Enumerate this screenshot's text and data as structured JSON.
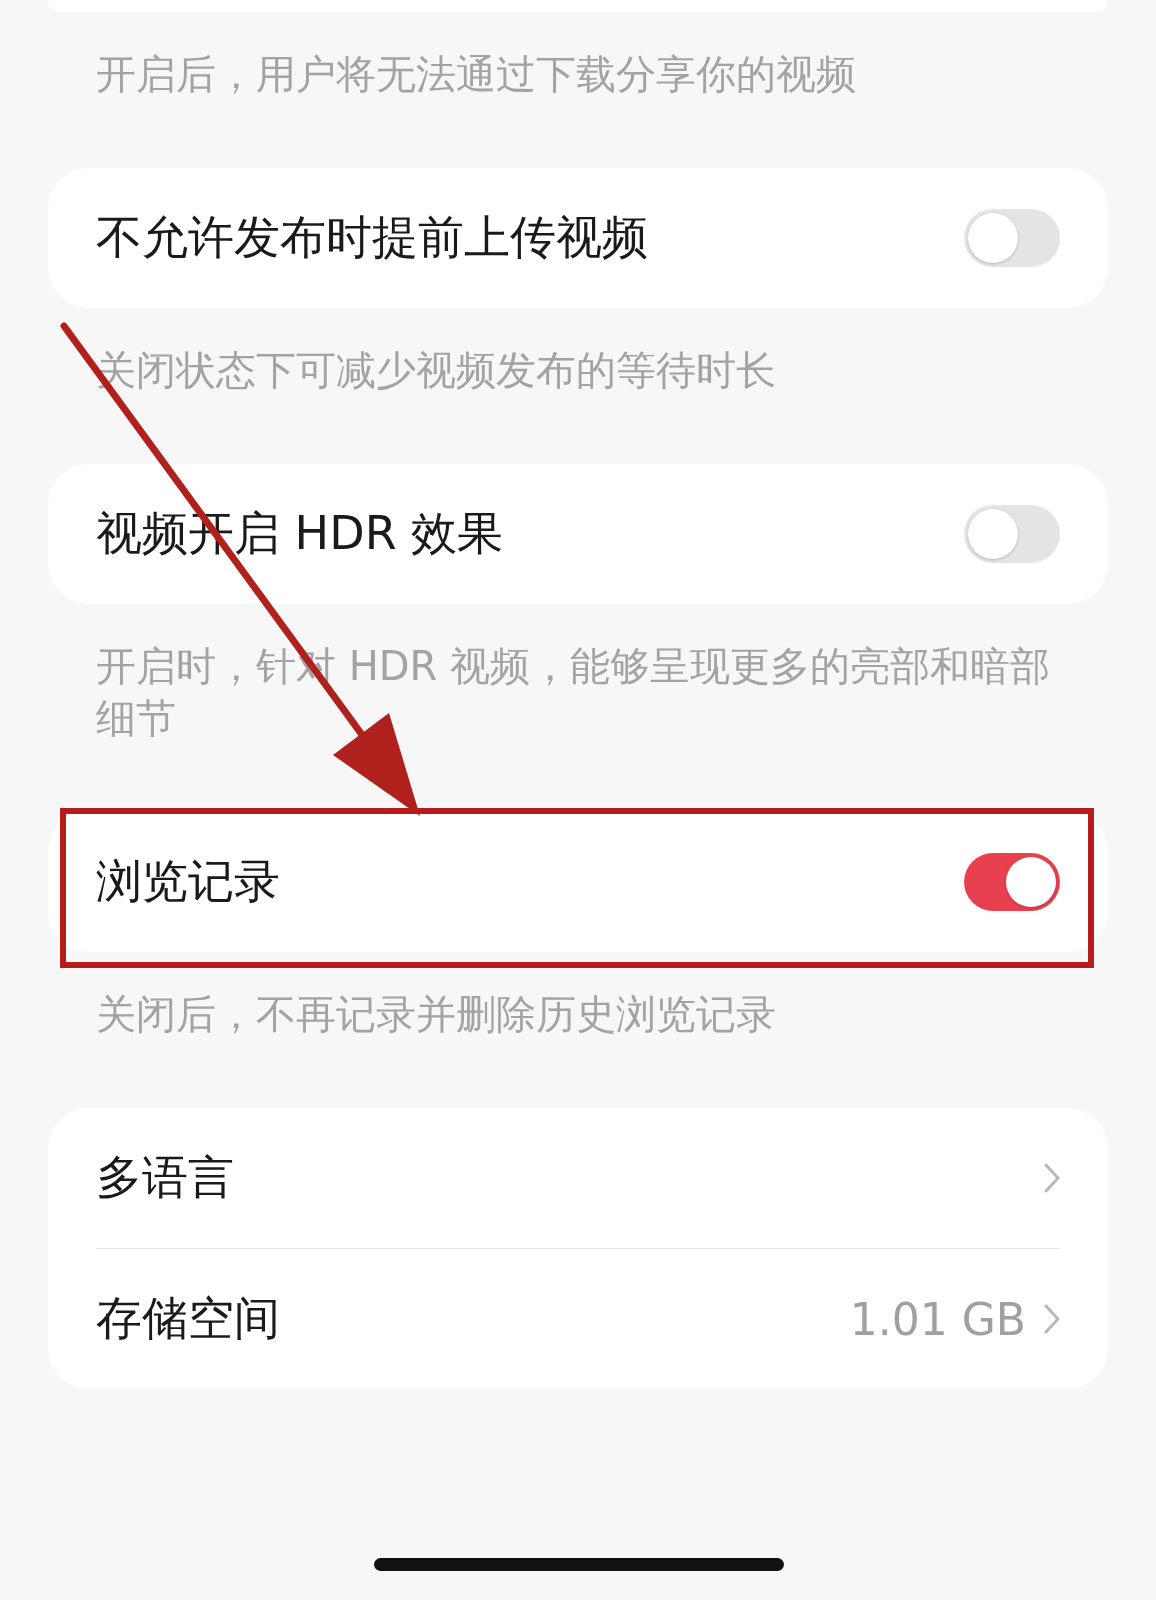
{
  "top_note": "开启后，用户将无法通过下载分享你的视频",
  "sections": [
    {
      "highlighted": false,
      "rows": [
        {
          "kind": "toggle",
          "label": "不允许发布时提前上传视频",
          "on": false
        }
      ],
      "note": "关闭状态下可减少视频发布的等待时长"
    },
    {
      "highlighted": false,
      "rows": [
        {
          "kind": "toggle",
          "label": "视频开启 HDR 效果",
          "on": false
        }
      ],
      "note": "开启时，针对 HDR 视频，能够呈现更多的亮部和暗部细节"
    },
    {
      "highlighted": true,
      "rows": [
        {
          "kind": "toggle",
          "label": "浏览记录",
          "on": true
        }
      ],
      "note": "关闭后，不再记录并删除历史浏览记录"
    },
    {
      "highlighted": false,
      "rows": [
        {
          "kind": "link",
          "label": "多语言"
        },
        {
          "kind": "link",
          "label": "存储空间",
          "value": "1.01 GB"
        }
      ]
    }
  ]
}
